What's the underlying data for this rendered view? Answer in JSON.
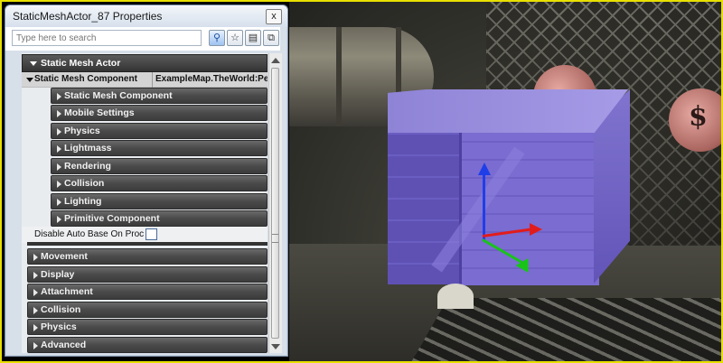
{
  "window": {
    "title": "StaticMeshActor_87 Properties",
    "close_glyph": "x"
  },
  "search": {
    "placeholder": "Type here to search"
  },
  "toolbar": {
    "icons": [
      "search-go-icon",
      "star-icon",
      "lock-icon",
      "copy-icon"
    ]
  },
  "grid": {
    "header": "Static Mesh Actor",
    "component_row": {
      "label": "Static Mesh Component",
      "value": "ExampleMap.TheWorld:PersistentLevel"
    },
    "sub_categories": [
      "Static Mesh Component",
      "Mobile Settings",
      "Physics",
      "Lightmass",
      "Rendering",
      "Collision",
      "Lighting",
      "Primitive Component"
    ],
    "bool_row": {
      "label": "Disable Auto Base On Proc Build",
      "checked": false
    },
    "categories": [
      "Movement",
      "Display",
      "Attachment",
      "Collision",
      "Physics",
      "Advanced"
    ]
  },
  "viewport": {
    "coin_symbol": "$"
  }
}
